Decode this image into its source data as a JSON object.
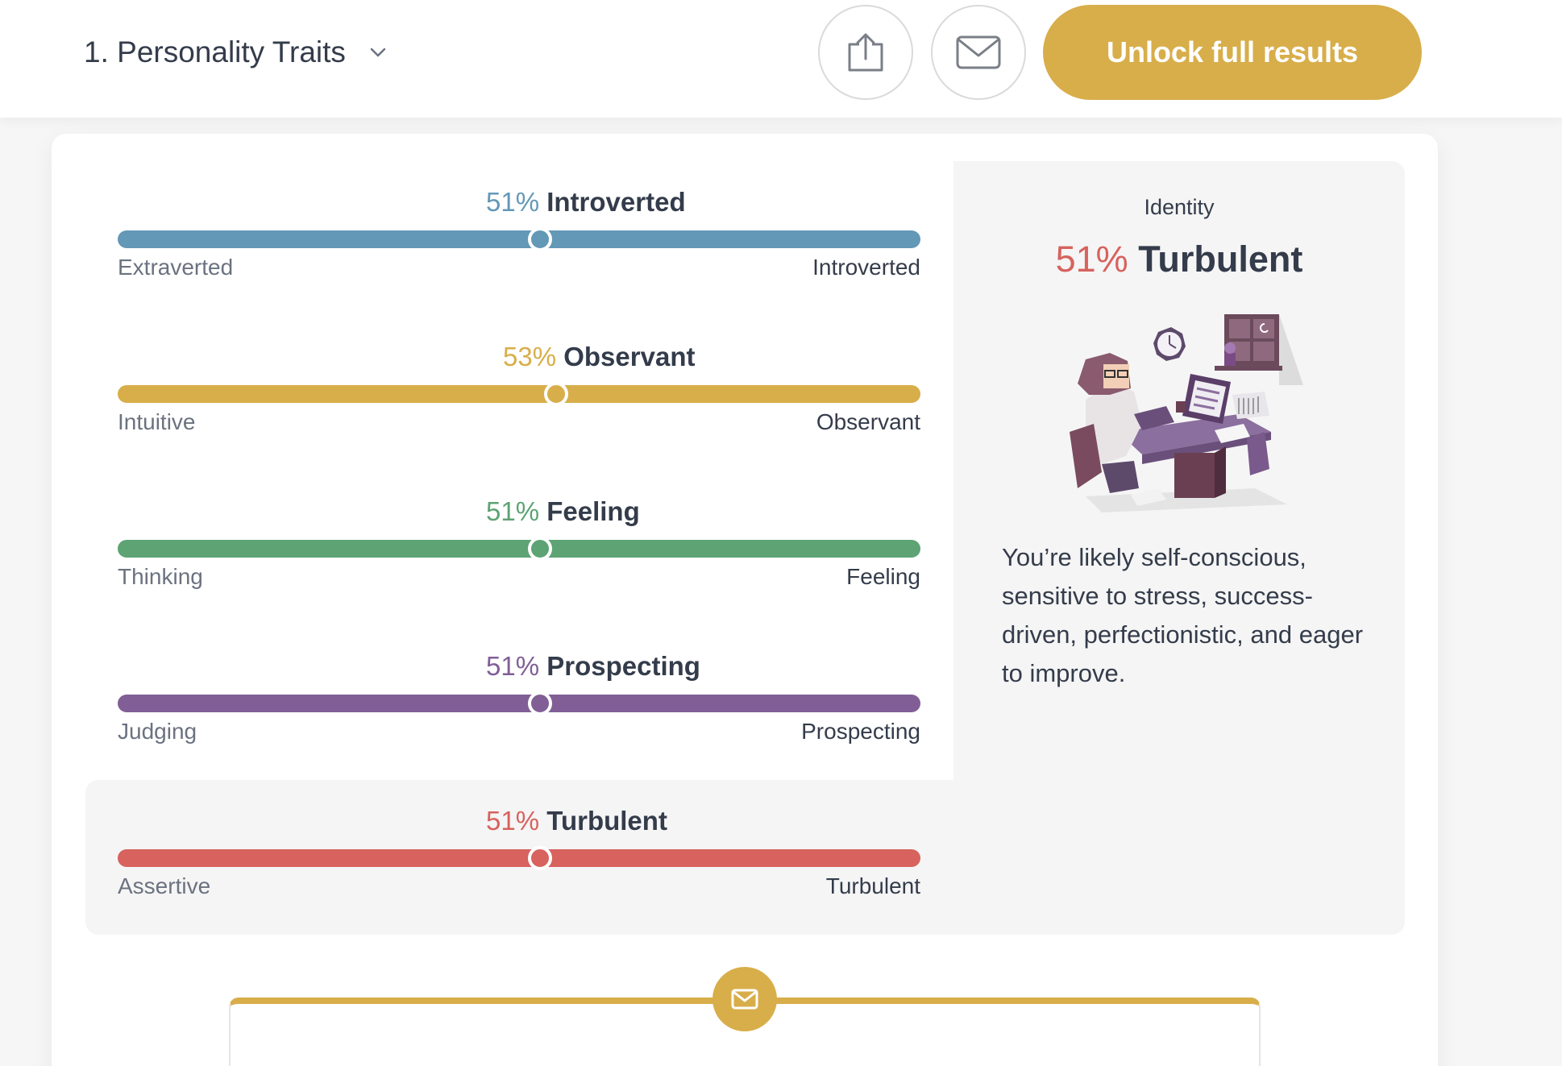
{
  "header": {
    "section_title": "1. Personality Traits",
    "unlock_label": "Unlock full results",
    "share_icon": "share-icon",
    "mail_icon": "mail-icon"
  },
  "colors": {
    "accent": "#d8ae4a",
    "energy": "#6398b6",
    "mind": "#d8ae4a",
    "nature": "#5da374",
    "tactics": "#815f96",
    "identity": "#d7625e"
  },
  "traits": [
    {
      "pct": "51%",
      "name": "Introverted",
      "left": "Extraverted",
      "right": "Introverted",
      "value": 51,
      "side": "right"
    },
    {
      "pct": "53%",
      "name": "Observant",
      "left": "Intuitive",
      "right": "Observant",
      "value": 53,
      "side": "right"
    },
    {
      "pct": "51%",
      "name": "Feeling",
      "left": "Thinking",
      "right": "Feeling",
      "value": 51,
      "side": "right"
    },
    {
      "pct": "51%",
      "name": "Prospecting",
      "left": "Judging",
      "right": "Prospecting",
      "value": 51,
      "side": "right"
    },
    {
      "pct": "51%",
      "name": "Turbulent",
      "left": "Assertive",
      "right": "Turbulent",
      "value": 51,
      "side": "right"
    }
  ],
  "identity": {
    "label": "Identity",
    "pct": "51%",
    "name": "Turbulent",
    "description": "You’re likely self-conscious, sensitive to stress, success-driven, perfectionistic, and eager to improve."
  }
}
